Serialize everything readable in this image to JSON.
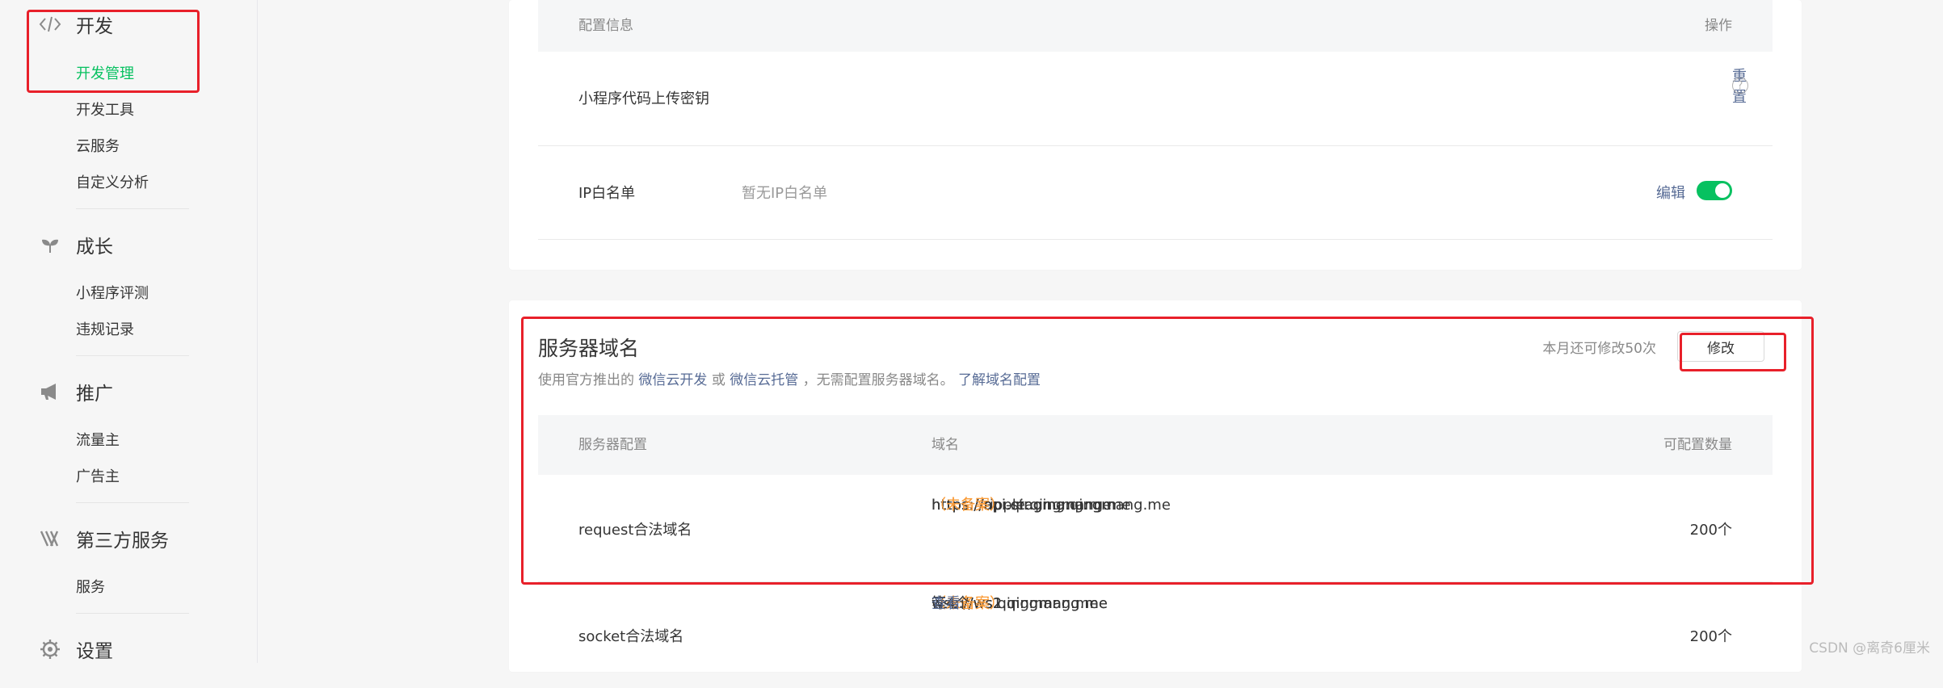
{
  "sidebar": {
    "groups": [
      {
        "title": "开发",
        "icon": "code-icon",
        "items": [
          "开发管理",
          "开发工具",
          "云服务",
          "自定义分析"
        ]
      },
      {
        "title": "成长",
        "icon": "sprout-icon",
        "items": [
          "小程序评测",
          "违规记录"
        ]
      },
      {
        "title": "推广",
        "icon": "megaphone-icon",
        "items": [
          "流量主",
          "广告主"
        ]
      },
      {
        "title": "第三方服务",
        "icon": "third-party-icon",
        "items": [
          "服务"
        ]
      },
      {
        "title": "设置",
        "icon": "gear-icon",
        "items": []
      }
    ],
    "active_item": "开发管理"
  },
  "config_panel": {
    "header_left": "配置信息",
    "header_right": "操作",
    "rows": [
      {
        "label": "小程序代码上传密钥",
        "value": "",
        "action": "重置",
        "help": "?"
      },
      {
        "label": "IP白名单",
        "value": "暂无IP白名单",
        "action": "编辑",
        "toggle_on": true
      }
    ]
  },
  "server_domain": {
    "title": "服务器域名",
    "remaining": "本月还可修改50次",
    "modify_button": "修改",
    "desc_prefix": "使用官方推出的",
    "desc_link1": "微信云开发",
    "desc_or": "或",
    "desc_link2": "微信云托管",
    "desc_middle": "，无需配置服务器域名。",
    "desc_link3": "了解域名配置",
    "columns": [
      "服务器配置",
      "域名",
      "可配置数量"
    ],
    "rows": [
      {
        "label": "request合法域名",
        "domains": [
          {
            "url": "https://api.qingmang.me",
            "status": "（未备案）"
          },
          {
            "url": "https://ripple.qingmang.me",
            "status": "（未备案）"
          },
          {
            "url": "https://api-staging.qingmang.me",
            "status": "（未备案）"
          }
        ],
        "count": "200个"
      },
      {
        "label": "socket合法域名",
        "domains": [
          {
            "url": "wss://ws.qingmang.me",
            "status": "（未备案）"
          },
          {
            "url": "wss://ws1.qingmang.me",
            "status": "（未备案）"
          },
          {
            "url": "wss://ws2.qingmang.me",
            "status": "（未备案）"
          }
        ],
        "more_text": "等4个",
        "more_link": "查看",
        "count": "200个"
      }
    ]
  },
  "watermark": "CSDN @离奇6厘米",
  "colors": {
    "accent": "#07c160",
    "link": "#576b95",
    "warning": "#fa9d3b",
    "highlight": "#e8202a"
  }
}
